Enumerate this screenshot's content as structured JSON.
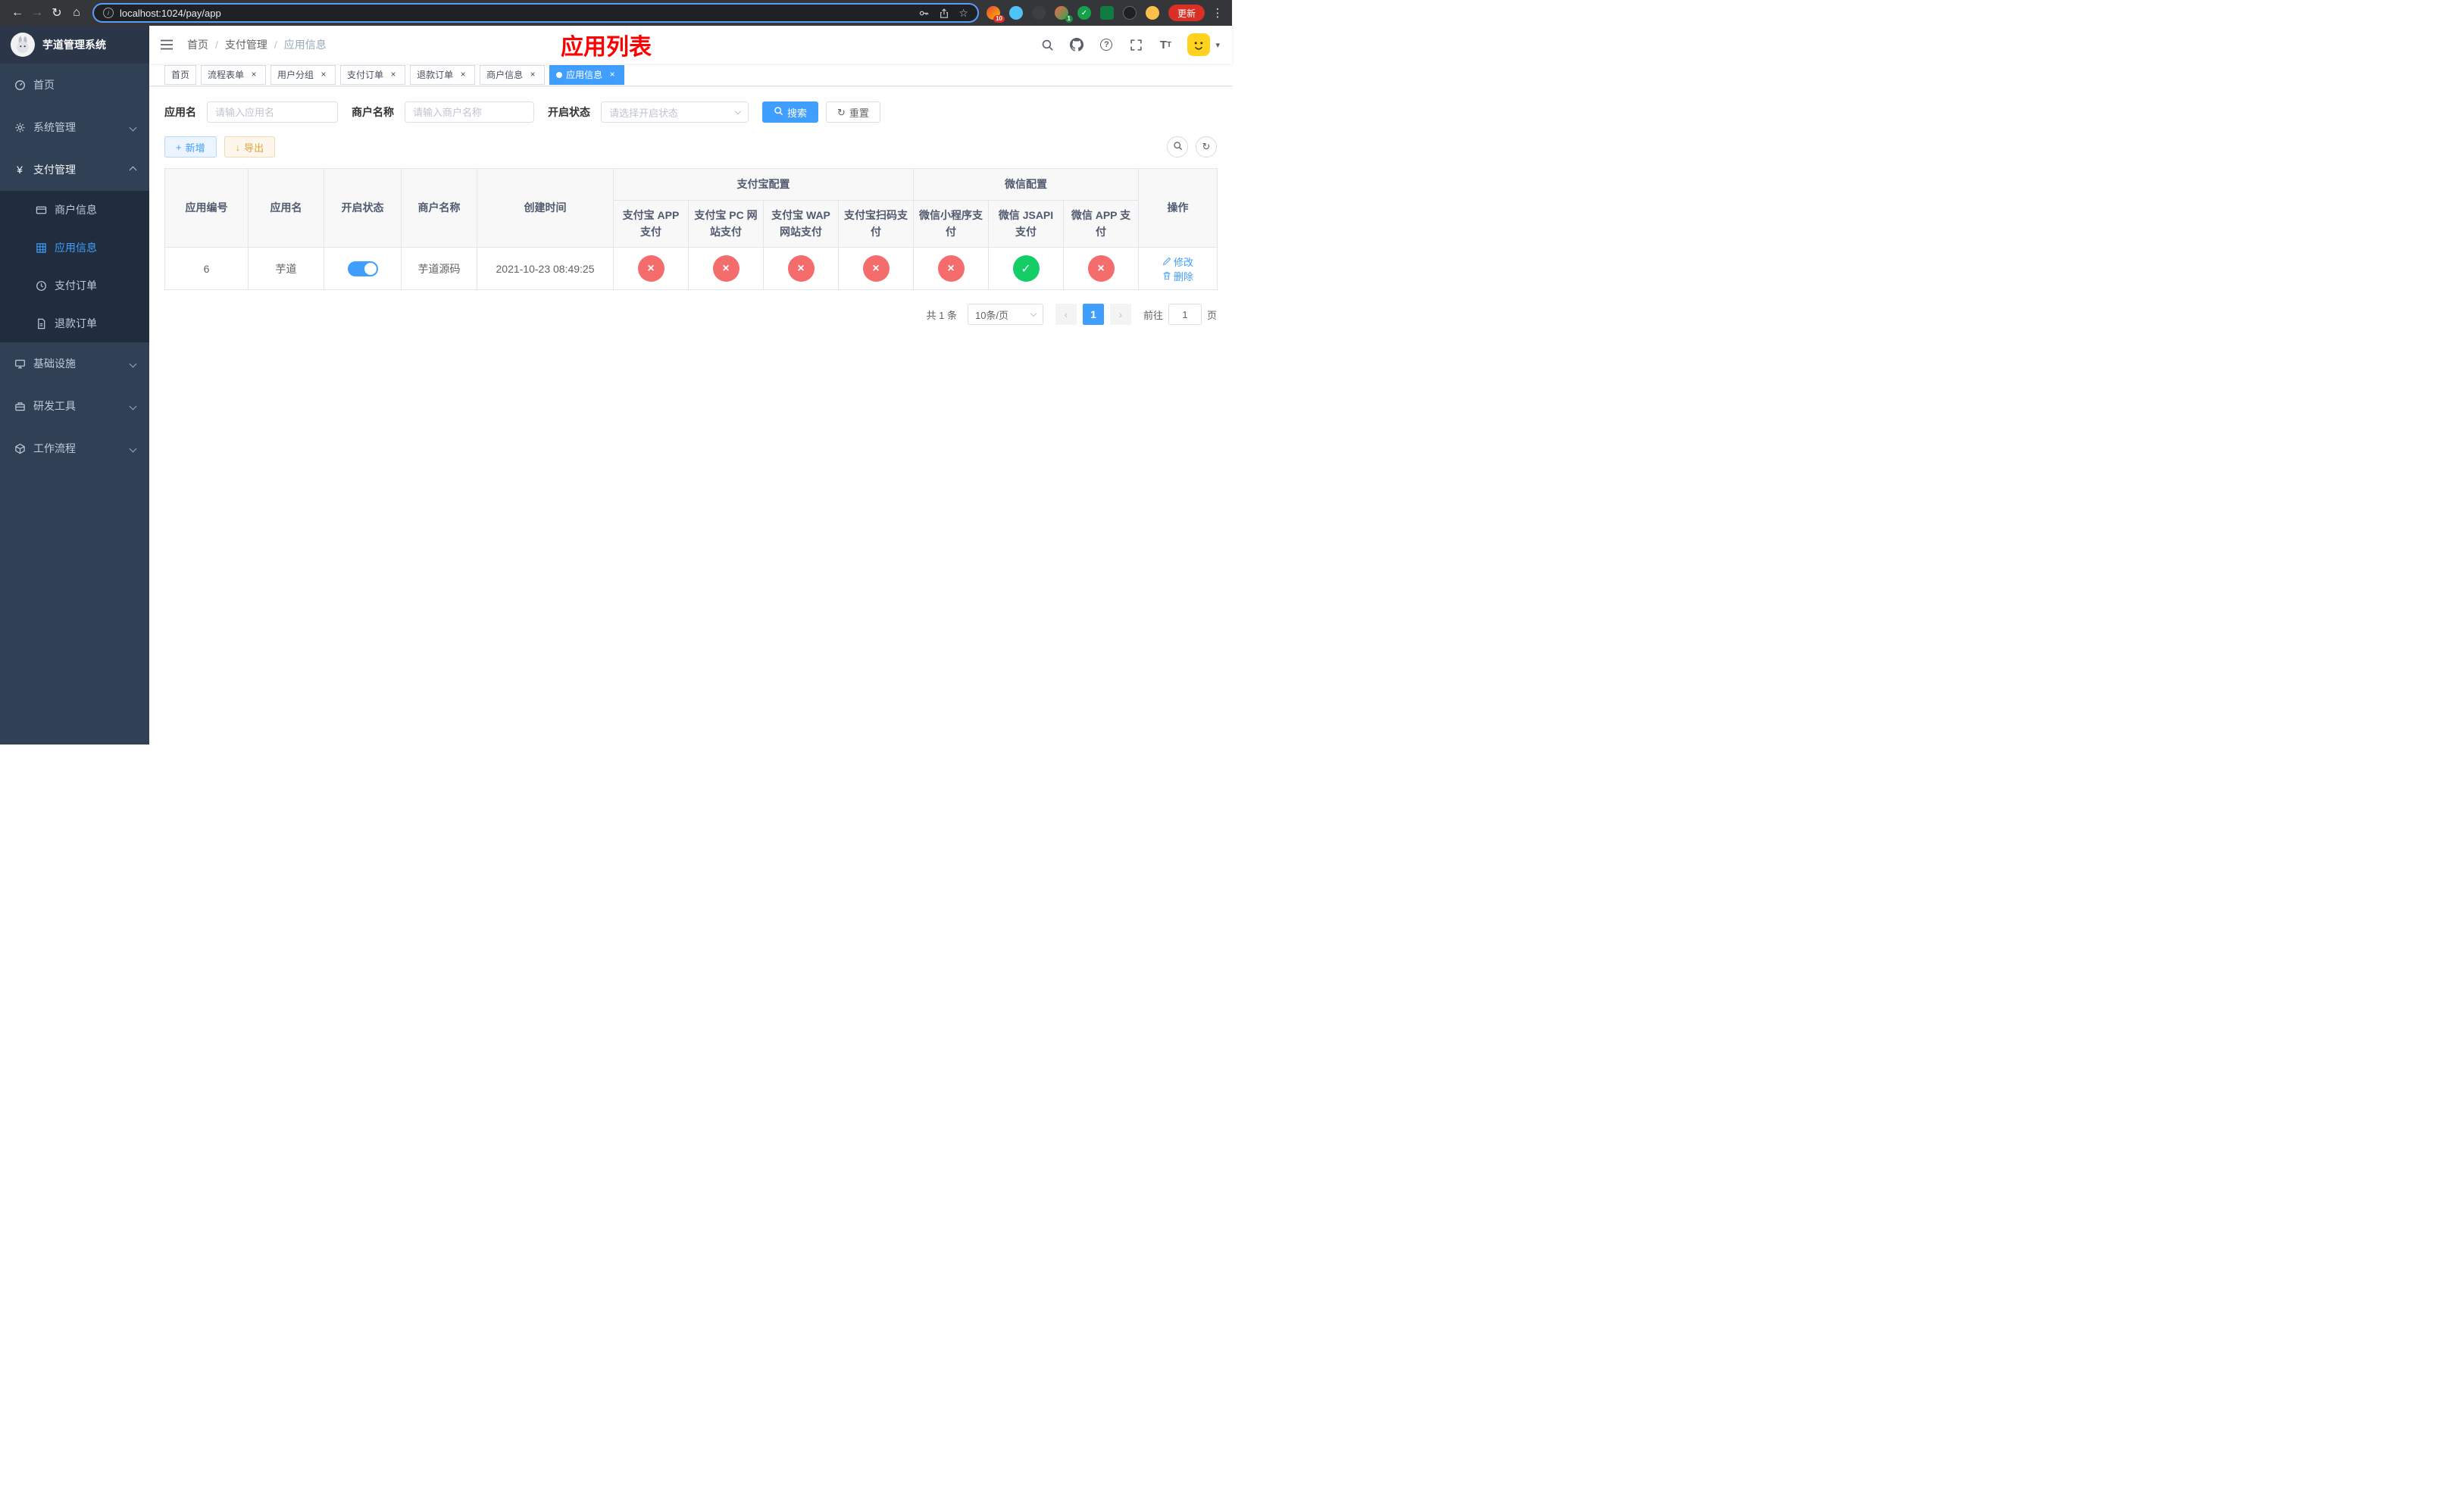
{
  "browser": {
    "url": "localhost:1024/pay/app",
    "update_label": "更新",
    "badges": {
      "ext1": "10",
      "ext4": "1"
    }
  },
  "icons": {
    "back": "←",
    "forward": "→",
    "reload": "↻",
    "home": "⌂",
    "info": "i",
    "star": "☆",
    "menu_dots": "⋮",
    "plus": "+",
    "download": "↓",
    "refresh": "↻",
    "check": "✓",
    "cross": "×",
    "close": "×",
    "caret_down": "▾",
    "help": "?",
    "prev": "‹",
    "next": "›",
    "yen": "¥",
    "font_big": "T",
    "font_small": "T"
  },
  "sidebar": {
    "app_title": "芋道管理系统",
    "menu": [
      {
        "label": "首页"
      },
      {
        "label": "系统管理"
      },
      {
        "label": "支付管理"
      },
      {
        "label": "基础设施"
      },
      {
        "label": "研发工具"
      },
      {
        "label": "工作流程"
      }
    ],
    "payment_children": [
      {
        "label": "商户信息"
      },
      {
        "label": "应用信息"
      },
      {
        "label": "支付订单"
      },
      {
        "label": "退款订单"
      }
    ]
  },
  "breadcrumb": {
    "items": [
      "首页",
      "支付管理",
      "应用信息"
    ],
    "separator": "/"
  },
  "page_title": "应用列表",
  "tags": [
    {
      "label": "首页"
    },
    {
      "label": "流程表单"
    },
    {
      "label": "用户分组"
    },
    {
      "label": "支付订单"
    },
    {
      "label": "退款订单"
    },
    {
      "label": "商户信息"
    },
    {
      "label": "应用信息"
    }
  ],
  "filters": {
    "app_name": {
      "label": "应用名",
      "placeholder": "请输入应用名"
    },
    "merchant": {
      "label": "商户名称",
      "placeholder": "请输入商户名称"
    },
    "status": {
      "label": "开启状态",
      "placeholder": "请选择开启状态"
    },
    "search_label": "搜索",
    "reset_label": "重置"
  },
  "toolbar": {
    "add_label": "新增",
    "export_label": "导出"
  },
  "table": {
    "headers": {
      "app_id": "应用编号",
      "app_name": "应用名",
      "status": "开启状态",
      "merchant": "商户名称",
      "created": "创建时间",
      "alipay_group": "支付宝配置",
      "wechat_group": "微信配置",
      "actions": "操作",
      "configs": [
        "支付宝 APP 支付",
        "支付宝 PC 网站支付",
        "支付宝 WAP 网站支付",
        "支付宝扫码支付",
        "微信小程序支付",
        "微信 JSAPI 支付",
        "微信 APP 支付"
      ]
    },
    "row": {
      "app_id": "6",
      "app_name": "芋道",
      "status_on": true,
      "merchant": "芋道源码",
      "created": "2021-10-23 08:49:25",
      "configs": [
        false,
        false,
        false,
        false,
        false,
        true,
        false
      ],
      "edit_label": "修改",
      "delete_label": "删除"
    }
  },
  "pagination": {
    "total": "共 1 条",
    "page_size": "10条/页",
    "current_page": "1",
    "goto_label": "前往",
    "goto_value": "1",
    "unit_label": "页"
  }
}
